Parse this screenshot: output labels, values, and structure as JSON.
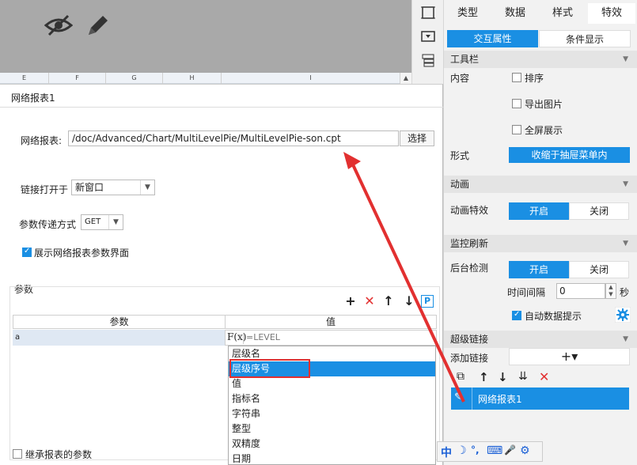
{
  "sheet": {
    "columns": [
      "E",
      "F",
      "G",
      "H",
      "I"
    ]
  },
  "right_panel": {
    "tabs": [
      "类型",
      "数据",
      "样式",
      "特效"
    ],
    "active_tab": "特效",
    "subtabs": [
      "交互属性",
      "条件显示"
    ],
    "toolbar_section": {
      "title": "工具栏",
      "content_label": "内容",
      "options": [
        {
          "label": "排序",
          "checked": false
        },
        {
          "label": "导出图片",
          "checked": false
        },
        {
          "label": "全屏展示",
          "checked": false
        }
      ],
      "form_label": "形式",
      "form_value": "收缩于抽屉菜单内"
    },
    "animation_section": {
      "title": "动画",
      "effect_label": "动画特效",
      "on": "开启",
      "off": "关闭"
    },
    "monitor_section": {
      "title": "监控刷新",
      "background_label": "后台检测",
      "on": "开启",
      "off": "关闭",
      "interval_label": "时间间隔",
      "interval_value": "0",
      "interval_unit": "秒",
      "auto_tip_label": "自动数据提示",
      "auto_tip_checked": true
    },
    "hyperlink_section": {
      "title": "超级链接",
      "add_label": "添加链接",
      "add_button": "+▾",
      "link_item": "网络报表1"
    }
  },
  "dialog": {
    "title": "网络报表1",
    "report_label": "网络报表:",
    "report_path": "/doc/Advanced/Chart/MultiLevelPie/MultiLevelPie-son.cpt",
    "choose_button": "选择",
    "open_label": "链接打开于",
    "open_value": "新窗口",
    "method_label": "参数传递方式",
    "method_value": "GET",
    "show_params_label": "展示网络报表参数界面",
    "show_params_checked": true,
    "params_group_label": "参数",
    "table_headers": [
      "参数",
      "值"
    ],
    "param_row": {
      "name": "a",
      "fx": "F(x)",
      "value": "=LEVEL"
    },
    "dropdown_items": [
      "层级名",
      "层级序号",
      "值",
      "指标名",
      "字符串",
      "整型",
      "双精度",
      "日期"
    ],
    "selected_item": "层级序号",
    "inherit_label": "继承报表的参数",
    "inherit_checked": false
  },
  "ime_bar": [
    "中",
    "☽",
    "°,",
    "⌨",
    "🎤",
    "⚙"
  ],
  "colors": {
    "accent": "#1a8fe3",
    "annotation_red": "#e23030"
  }
}
